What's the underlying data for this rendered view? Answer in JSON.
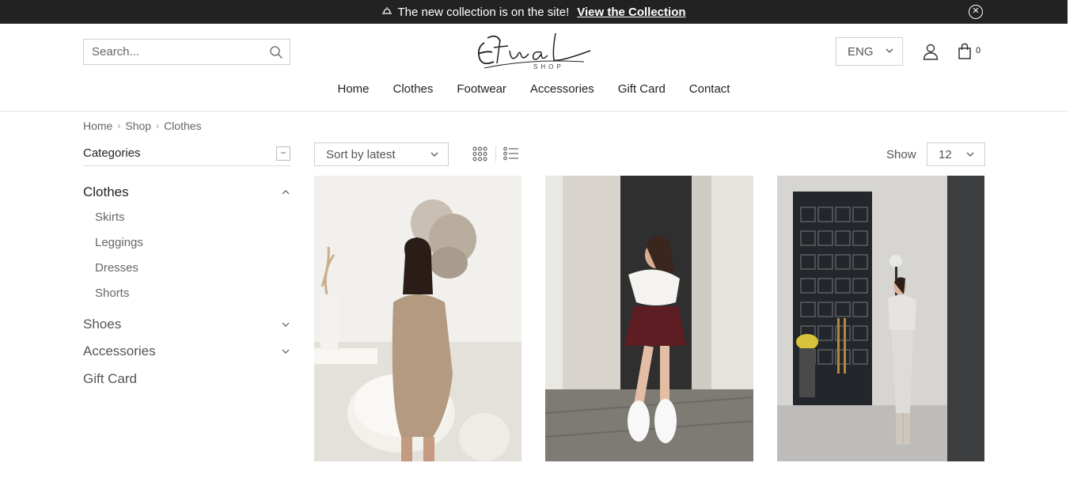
{
  "banner": {
    "message": "The new collection is on the site!",
    "link_label": "View the Collection",
    "close_symbol": "✕",
    "bell_symbol": "🔔"
  },
  "header": {
    "search_placeholder": "Search...",
    "language": "ENG",
    "cart_count": "0",
    "logo_alt": "Etual Shop"
  },
  "nav": {
    "items": [
      {
        "label": "Home"
      },
      {
        "label": "Clothes"
      },
      {
        "label": "Footwear"
      },
      {
        "label": "Accessories"
      },
      {
        "label": "Gift Card"
      },
      {
        "label": "Contact"
      }
    ]
  },
  "breadcrumb": {
    "items": [
      "Home",
      "Shop",
      "Clothes"
    ],
    "separator": "›"
  },
  "sidebar": {
    "heading": "Categories",
    "toggle_symbol": "−",
    "categories": [
      {
        "label": "Clothes",
        "expanded": true,
        "subs": [
          "Skirts",
          "Leggings",
          "Dresses",
          "Shorts"
        ]
      },
      {
        "label": "Shoes",
        "expanded": false
      },
      {
        "label": "Accessories",
        "expanded": false
      },
      {
        "label": "Gift Card"
      }
    ]
  },
  "toolbar": {
    "sort_label": "Sort by latest",
    "show_label": "Show",
    "show_value": "12"
  },
  "products": [
    {
      "image": "woman-in-beige-knit-dress"
    },
    {
      "image": "woman-in-white-top-and-burgundy-skirt"
    },
    {
      "image": "woman-in-grey-knit-set"
    }
  ],
  "colors": {
    "banner_bg": "#222222",
    "text": "#222222",
    "muted": "#666666",
    "border": "#cfcfcf"
  }
}
